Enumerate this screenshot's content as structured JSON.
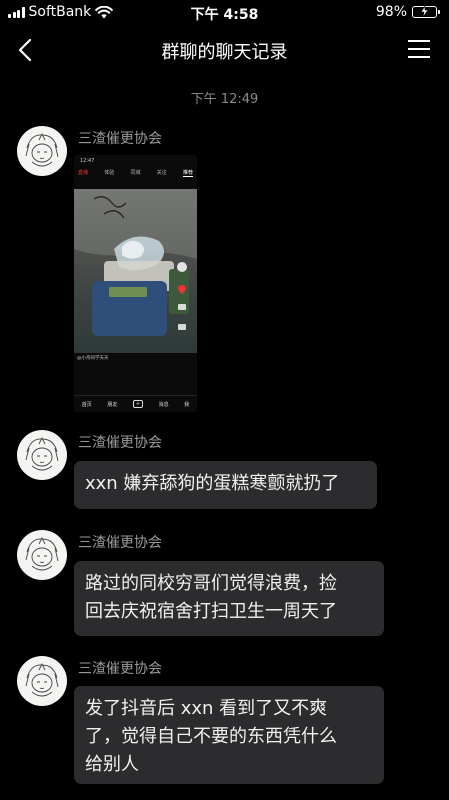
{
  "status_bar": {
    "carrier": "SoftBank",
    "time": "下午 4:58",
    "battery": "98%",
    "battery_level": 0.98
  },
  "nav": {
    "title": "群聊的聊天记录"
  },
  "timestamp": "下午 12:49",
  "messages": [
    {
      "sender": "三渣催更协会",
      "type": "image"
    },
    {
      "sender": "三渣催更协会",
      "text": "xxn 嫌弃舔狗的蛋糕寒颤就扔了"
    },
    {
      "sender": "三渣催更协会",
      "lines": [
        "路过的同校穷哥们觉得浪费，捡",
        "回去庆祝宿舍打扫卫生一周天了"
      ]
    },
    {
      "sender": "三渣催更协会",
      "lines": [
        "发了抖音后 xxn 看到了又不爽",
        "了，觉得自己不要的东西凭什么",
        "给别人"
      ]
    }
  ],
  "embedded_screenshot": {
    "time": "12:47",
    "tabs": [
      "直播",
      "体验",
      "同城",
      "关注",
      "推荐"
    ],
    "caption_handle": "@小舟同学天天",
    "bottom_tabs": [
      "首页",
      "朋友",
      "+",
      "消息",
      "我"
    ]
  }
}
